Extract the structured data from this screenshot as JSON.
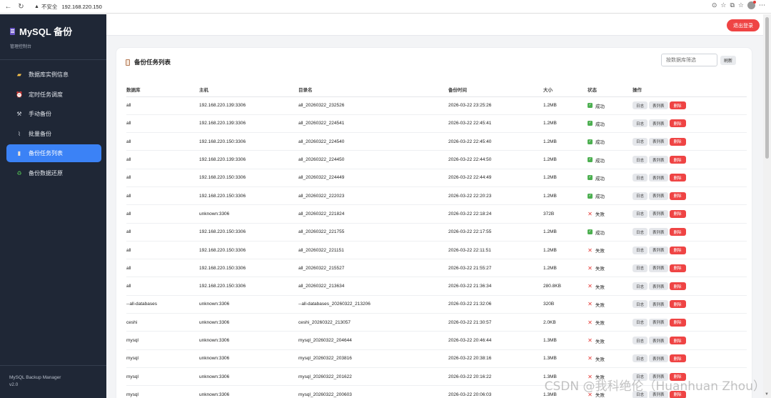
{
  "browser": {
    "insecure_label": "不安全",
    "url": "192.168.220.150"
  },
  "sidebar": {
    "title": "MySQL 备份",
    "subtitle": "管理控制台",
    "items": [
      {
        "label": "数据库实例信息",
        "icon": "folder-icon"
      },
      {
        "label": "定时任务调度",
        "icon": "alarm-clock-icon"
      },
      {
        "label": "手动备份",
        "icon": "tools-icon"
      },
      {
        "label": "批量备份",
        "icon": "paperclip-icon"
      },
      {
        "label": "备份任务列表",
        "icon": "clipboard-icon",
        "active": true
      },
      {
        "label": "备份数据还原",
        "icon": "recycle-icon"
      }
    ],
    "footer_name": "MySQL Backup Manager",
    "footer_version": "v2.0"
  },
  "topbar": {
    "logout_label": "退出登录"
  },
  "panel": {
    "title": "备份任务列表",
    "filter_placeholder": "按数据库筛选",
    "refresh_label": "刷新"
  },
  "table": {
    "headers": [
      "数据库",
      "主机",
      "目录名",
      "备份时间",
      "大小",
      "状态",
      "操作"
    ],
    "actions": {
      "log": "日志",
      "tables": "表列表",
      "delete": "删除"
    },
    "rows": [
      {
        "db": "all",
        "host": "192.168.220.139:3306",
        "dir": "all_20260322_232526",
        "time": "2026-03-22 23:25:26",
        "size": "1.2MB",
        "status": "成功",
        "ok": true
      },
      {
        "db": "all",
        "host": "192.168.220.139:3306",
        "dir": "all_20260322_224541",
        "time": "2026-03-22 22:45:41",
        "size": "1.2MB",
        "status": "成功",
        "ok": true
      },
      {
        "db": "all",
        "host": "192.168.220.150:3306",
        "dir": "all_20260322_224540",
        "time": "2026-03-22 22:45:40",
        "size": "1.2MB",
        "status": "成功",
        "ok": true
      },
      {
        "db": "all",
        "host": "192.168.220.139:3306",
        "dir": "all_20260322_224450",
        "time": "2026-03-22 22:44:50",
        "size": "1.2MB",
        "status": "成功",
        "ok": true
      },
      {
        "db": "all",
        "host": "192.168.220.150:3306",
        "dir": "all_20260322_224449",
        "time": "2026-03-22 22:44:49",
        "size": "1.2MB",
        "status": "成功",
        "ok": true
      },
      {
        "db": "all",
        "host": "192.168.220.150:3306",
        "dir": "all_20260322_222023",
        "time": "2026-03-22 22:20:23",
        "size": "1.2MB",
        "status": "成功",
        "ok": true
      },
      {
        "db": "all",
        "host": "unknown:3306",
        "dir": "all_20260322_221824",
        "time": "2026-03-22 22:18:24",
        "size": "372B",
        "status": "失败",
        "ok": false
      },
      {
        "db": "all",
        "host": "192.168.220.150:3306",
        "dir": "all_20260322_221755",
        "time": "2026-03-22 22:17:55",
        "size": "1.2MB",
        "status": "成功",
        "ok": true
      },
      {
        "db": "all",
        "host": "192.168.220.150:3306",
        "dir": "all_20260322_221151",
        "time": "2026-03-22 22:11:51",
        "size": "1.2MB",
        "status": "失败",
        "ok": false
      },
      {
        "db": "all",
        "host": "192.168.220.150:3306",
        "dir": "all_20260322_215527",
        "time": "2026-03-22 21:55:27",
        "size": "1.2MB",
        "status": "失败",
        "ok": false
      },
      {
        "db": "all",
        "host": "192.168.220.150:3306",
        "dir": "all_20260322_213634",
        "time": "2026-03-22 21:36:34",
        "size": "280.8KB",
        "status": "失败",
        "ok": false
      },
      {
        "db": "--all-databases",
        "host": "unknown:3306",
        "dir": "--all-databases_20260322_213206",
        "time": "2026-03-22 21:32:06",
        "size": "320B",
        "status": "失败",
        "ok": false
      },
      {
        "db": "ceshi",
        "host": "unknown:3306",
        "dir": "ceshi_20260322_213057",
        "time": "2026-03-22 21:30:57",
        "size": "2.0KB",
        "status": "失败",
        "ok": false
      },
      {
        "db": "mysql",
        "host": "unknown:3306",
        "dir": "mysql_20260322_204644",
        "time": "2026-03-22 20:46:44",
        "size": "1.3MB",
        "status": "失败",
        "ok": false
      },
      {
        "db": "mysql",
        "host": "unknown:3306",
        "dir": "mysql_20260322_203816",
        "time": "2026-03-22 20:38:16",
        "size": "1.3MB",
        "status": "失败",
        "ok": false
      },
      {
        "db": "mysql",
        "host": "unknown:3306",
        "dir": "mysql_20260322_201622",
        "time": "2026-03-22 20:16:22",
        "size": "1.3MB",
        "status": "失败",
        "ok": false
      },
      {
        "db": "mysql",
        "host": "unknown:3306",
        "dir": "mysql_20260322_200603",
        "time": "2026-03-22 20:06:03",
        "size": "1.3MB",
        "status": "失败",
        "ok": false
      }
    ]
  },
  "watermark": "CSDN @我科绝伦（Huanhuan Zhou）",
  "colors": {
    "sidebar_bg": "#1f2736",
    "accent": "#3b82f6",
    "danger": "#ef4444",
    "success": "#4caf50"
  }
}
